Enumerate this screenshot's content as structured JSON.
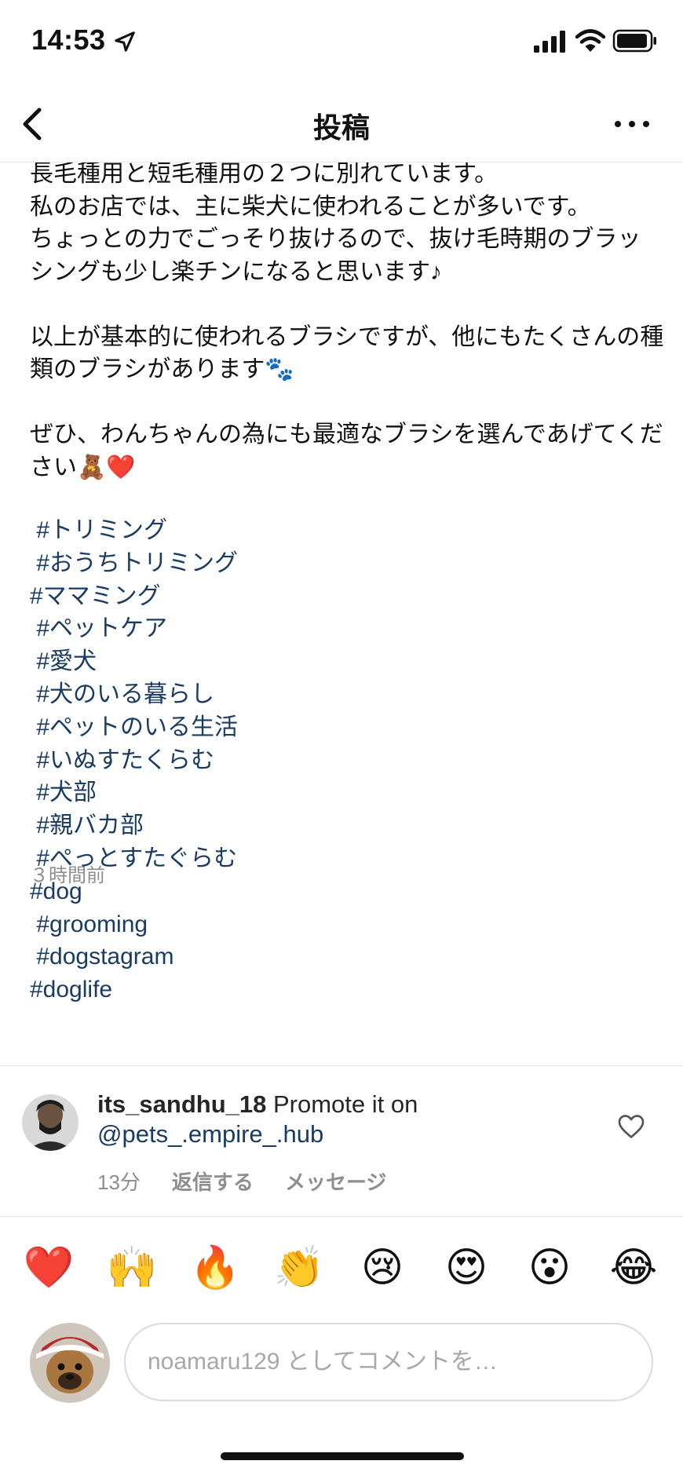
{
  "status_bar": {
    "time": "14:53"
  },
  "nav": {
    "title": "投稿"
  },
  "post": {
    "caption": "長毛種用と短毛種用の２つに別れています。\n私のお店では、主に柴犬に使われることが多いです。\nちょっとの力でごっそり抜けるので、抜け毛時期のブラッシングも少し楽チンになると思います♪\n\n以上が基本的に使われるブラシですが、他にもたくさんの種類のブラシがあります🐾\n\nぜひ、わんちゃんの為にも最適なブラシを選んであげてください🧸❤️",
    "hashtags": [
      " #トリミング",
      " #おうちトリミング",
      "#ママミング",
      " #ペットケア",
      " #愛犬",
      " #犬のいる暮らし",
      " #ペットのいる生活",
      " #いぬすたくらむ",
      " #犬部",
      " #親バカ部",
      " #ぺっとすたぐらむ",
      "#dog",
      " #grooming",
      " #dogstagram",
      "#doglife"
    ],
    "timestamp": "３時間前"
  },
  "comment": {
    "username": "its_sandhu_18",
    "text": " Promote it on ",
    "mention": "@pets_.empire_.hub",
    "time": "13分",
    "reply_label": "返信する",
    "message_label": "メッセージ"
  },
  "emoji_bar": [
    "❤️",
    "🙌",
    "🔥",
    "👏",
    "😢",
    "😍",
    "😮",
    "😂"
  ],
  "comment_input": {
    "placeholder": "noamaru129 としてコメントを…"
  },
  "colors": {
    "hashtag": "#1a3c63",
    "secondary_text": "#8e8e8e",
    "divider": "#e3e3e3"
  }
}
